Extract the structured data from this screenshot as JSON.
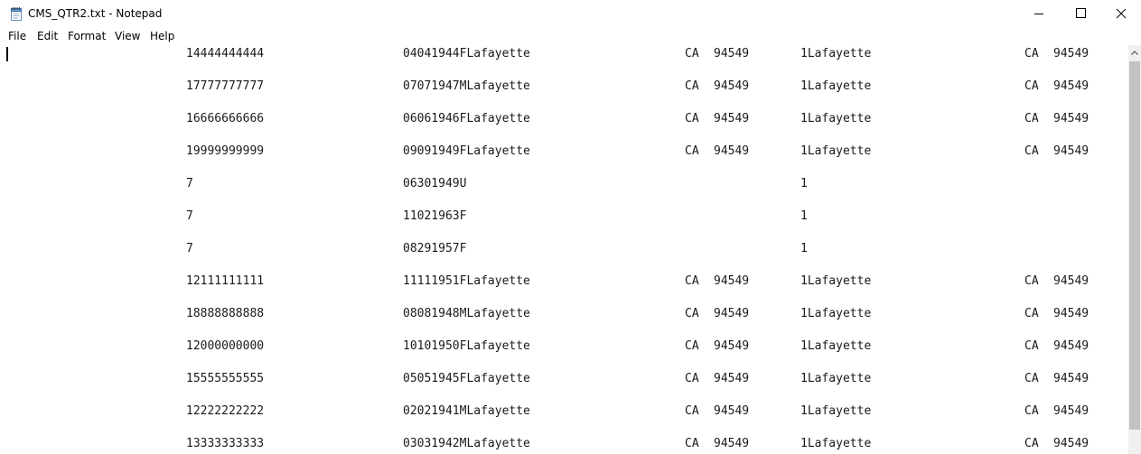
{
  "window": {
    "title": "CMS_QTR2.txt - Notepad"
  },
  "menu": {
    "items": [
      "File",
      "Edit",
      "Format",
      "View",
      "Help"
    ]
  },
  "icons": {
    "app": "notepad-icon",
    "minimize": "minimize-icon",
    "maximize": "maximize-icon",
    "close": "close-icon",
    "scroll_up": "chevron-up-icon"
  },
  "editor": {
    "lines": [
      [
        "14444444444",
        "04041944FLafayette",
        "CA",
        "94549",
        "1Lafayette",
        "CA",
        "94549"
      ],
      [
        "17777777777",
        "07071947MLafayette",
        "CA",
        "94549",
        "1Lafayette",
        "CA",
        "94549"
      ],
      [
        "16666666666",
        "06061946FLafayette",
        "CA",
        "94549",
        "1Lafayette",
        "CA",
        "94549"
      ],
      [
        "19999999999",
        "09091949FLafayette",
        "CA",
        "94549",
        "1Lafayette",
        "CA",
        "94549"
      ],
      [
        "7",
        "06301949U",
        "",
        "",
        "1",
        "",
        ""
      ],
      [
        "7",
        "11021963F",
        "",
        "",
        "1",
        "",
        ""
      ],
      [
        "7",
        "08291957F",
        "",
        "",
        "1",
        "",
        ""
      ],
      [
        "12111111111",
        "11111951FLafayette",
        "CA",
        "94549",
        "1Lafayette",
        "CA",
        "94549"
      ],
      [
        "18888888888",
        "08081948MLafayette",
        "CA",
        "94549",
        "1Lafayette",
        "CA",
        "94549"
      ],
      [
        "12000000000",
        "10101950FLafayette",
        "CA",
        "94549",
        "1Lafayette",
        "CA",
        "94549"
      ],
      [
        "15555555555",
        "05051945FLafayette",
        "CA",
        "94549",
        "1Lafayette",
        "CA",
        "94549"
      ],
      [
        "12222222222",
        "02021941MLafayette",
        "CA",
        "94549",
        "1Lafayette",
        "CA",
        "94549"
      ],
      [
        "13333333333",
        "03031942MLafayette",
        "CA",
        "94549",
        "1Lafayette",
        "CA",
        "94549"
      ]
    ]
  }
}
